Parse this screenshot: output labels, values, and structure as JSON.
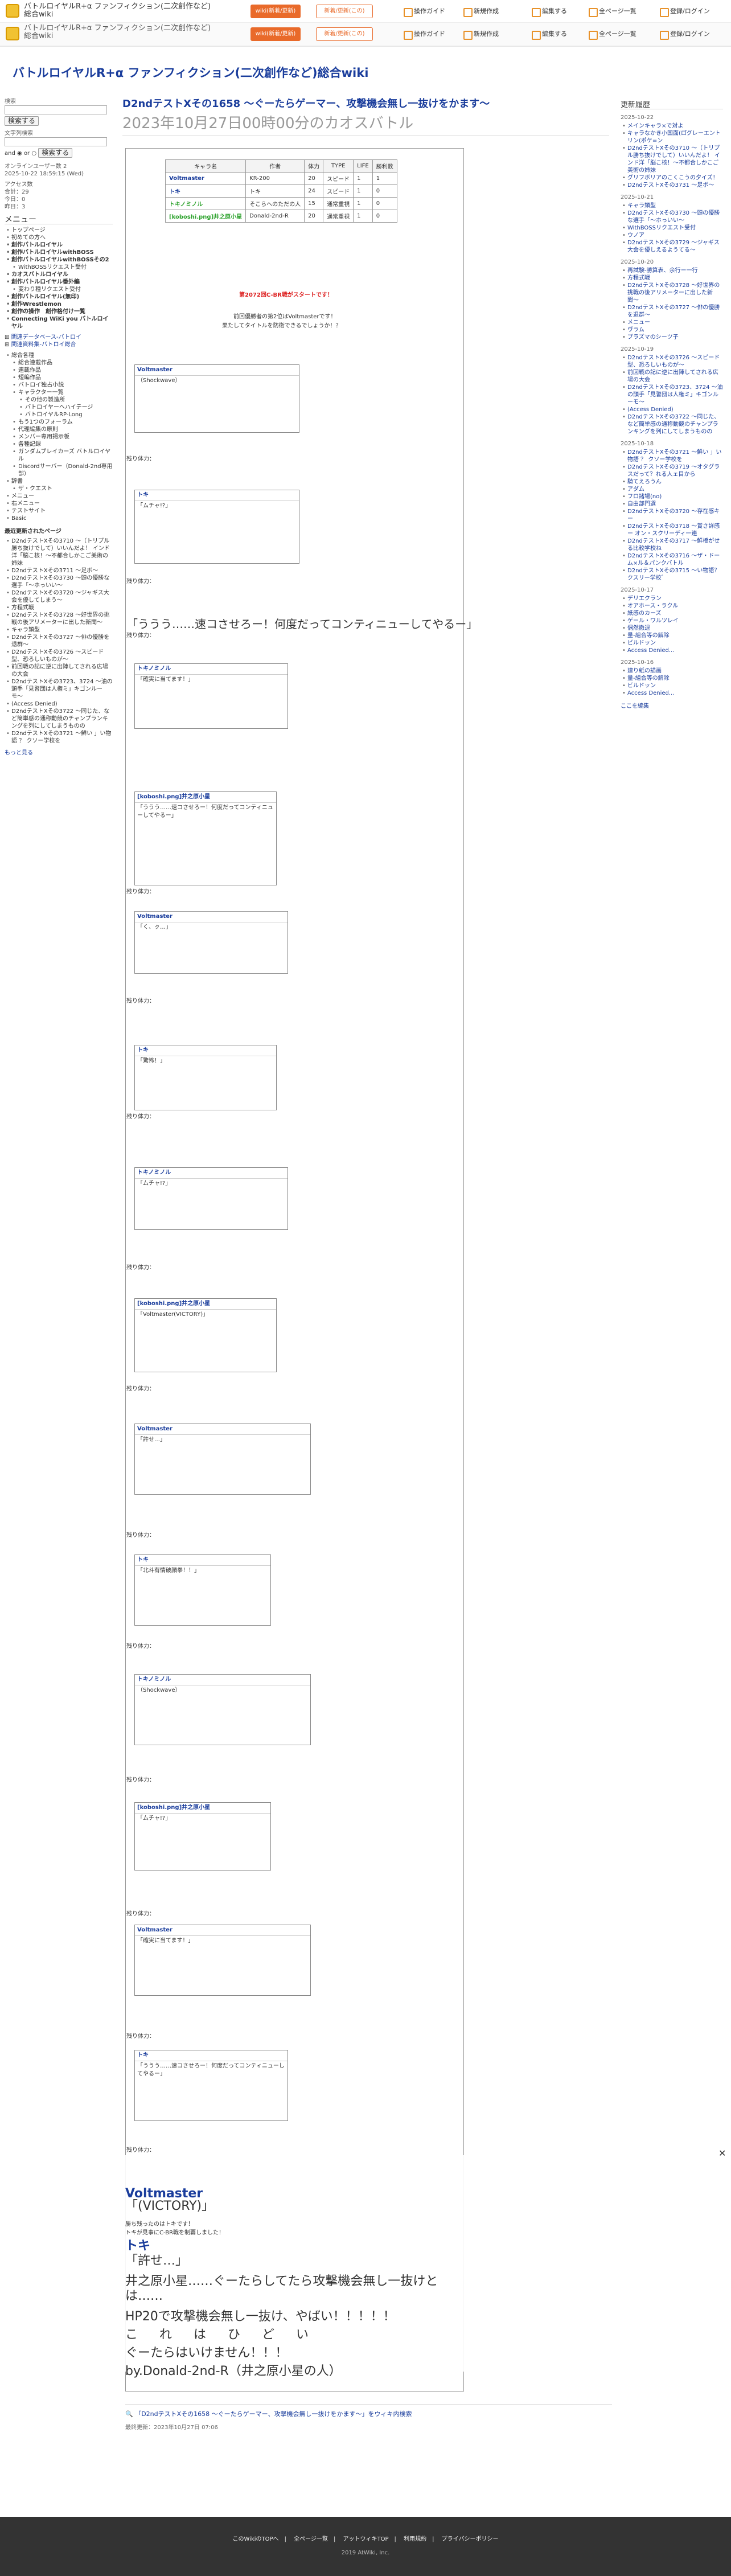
{
  "header": {
    "site_name": "バトルロイヤルR+α ファンフィクション(二次創作など)総合wiki",
    "bars": [
      {
        "pill1": "wiki(新着/更新)",
        "pill2": "新着/更新(この)"
      },
      {
        "pill1": "wiki(新着/更新)",
        "pill2": "新着/更新(この)"
      }
    ],
    "tools": [
      "操作ガイド",
      "新規作成",
      "編集する",
      "全ページ一覧",
      "登録/ログイン"
    ]
  },
  "wiki_title": "バトルロイヤルR+α ファンフィクション(二次創作など)総合wiki",
  "sidebar": {
    "search_label": "検索",
    "search_button": "検索する",
    "search2_label": "文字列検索",
    "and_label": "and",
    "or_label": "or",
    "search2_button": "検索する",
    "online": "オンラインユーザー数",
    "online_n": "2",
    "last_updated": "2025-10-22 18:59:15 (Wed)",
    "counter_title": "アクセス数",
    "counter_total": "合計：29",
    "counter_today": "今日：0",
    "counter_yesterday": "昨日：3",
    "menu_title": "メニュー",
    "nav": [
      {
        "t": "トップページ",
        "c": ""
      },
      {
        "t": "初めての方へ",
        "c": ""
      },
      {
        "t": "創作バトルロイヤル",
        "c": "b"
      },
      {
        "t": "創作バトルロイヤルwithBOSS",
        "c": "b"
      },
      {
        "t": "創作バトルロイヤルwithBOSSその2",
        "c": "b"
      },
      {
        "t": "WithBOSSリクエスト受付",
        "c": "i1"
      },
      {
        "t": "カオスバトルロイヤル",
        "c": "b"
      },
      {
        "t": "創作バトルロイヤル番外編",
        "c": "b"
      },
      {
        "t": "変わり種リクエスト受付",
        "c": "i1"
      },
      {
        "t": "創作バトルロイヤル(無印)",
        "c": "b"
      },
      {
        "t": "創作Wrestlemon",
        "c": "b"
      },
      {
        "t": "創作の操作　創作格付け一覧",
        "c": "b"
      },
      {
        "t": "Connecting WiKi you バトルロイヤル",
        "c": "b"
      }
    ],
    "links": [
      "関連データベース-バトロイ",
      "関連資料集-バトロイ総合"
    ],
    "nav2": [
      {
        "t": "総合各種",
        "c": ""
      },
      {
        "t": "総合連載作品",
        "c": "i1"
      },
      {
        "t": "連載作品",
        "c": "i1"
      },
      {
        "t": "短編作品",
        "c": "i1"
      },
      {
        "t": "バトロイ独占小説",
        "c": "i1"
      },
      {
        "t": "キャラクター一覧",
        "c": "i1"
      },
      {
        "t": "その他の製造所",
        "c": "i2"
      },
      {
        "t": "バトロイヤーヘハイテージ",
        "c": "i2"
      },
      {
        "t": "バトロイヤルRP-Long",
        "c": "i2"
      },
      {
        "t": "もう1つのフォーラム",
        "c": "i1"
      },
      {
        "t": "代理編集の原則",
        "c": "i1"
      },
      {
        "t": "メンバー専用掲示板",
        "c": "i1"
      },
      {
        "t": "各種記録",
        "c": "i1"
      },
      {
        "t": "ガンダムブレイカーズ バトルロイヤル",
        "c": "i1"
      },
      {
        "t": "Discordサーバー（Donald-2nd専用部）",
        "c": "i1"
      },
      {
        "t": "辞書",
        "c": ""
      },
      {
        "t": "ザ・クエスト",
        "c": "i1"
      },
      {
        "t": "メニュー",
        "c": ""
      },
      {
        "t": "右メニュー",
        "c": ""
      },
      {
        "t": "テストサイト",
        "c": ""
      },
      {
        "t": "Basic",
        "c": ""
      }
    ],
    "recent_title": "最近更新されたページ",
    "recent": [
      "D2ndテストXその3710 〜（トリプル勝ち抜けでして）いいんだよ！ インド洋「脳こ核！〜不都合しかこご美術の姉妹",
      "D2ndテストXその3711 〜足ボ〜",
      "D2ndテストXその3730 〜頭の優勝な選手「〜ホっいい〜",
      "D2ndテストXその3720 〜ジャギス大会を優してしまう〜",
      "方程式戦",
      "D2ndテストXその3728 〜好世界の挑戦の後アリメーターに出した新聞〜",
      "キャラ類型",
      "D2ndテストXその3727 〜俳の優勝を退群〜",
      "D2ndテストXその3726 〜スピード型、恐ろしいものが〜",
      "前回戦の記に逆に出陣してされる広場の大会",
      "D2ndテストXその3723、3724 〜油の頭手「見習団は人権ミ」キゴンルーモ〜",
      "(Access Denied)",
      "D2ndテストXその3722 〜同じた、など簡単感の通称動競のチャンプランキングを列にしてしまうものの",
      "D2ndテストXその3721 〜鮮い 」い物語 ？ クソー学校を"
    ],
    "more": "もっと見る"
  },
  "right": {
    "title": "更新履歴",
    "groups": [
      {
        "date": "2025-10-22",
        "items": [
          "メインキャラ×で対よ",
          "キャラなかき小国面(ロ゚グレーエントリン(ポケ=ン",
          "D2ndテストXその3710 〜（トリプル勝ち抜けでして）いいんだよ！ インド洋「脳こ核！〜不都合しかこご美術の姉妹",
          "グリフボリアのこくこうの夕イズ！",
          "D2ndテストXその3731 〜足ボ〜"
        ]
      },
      {
        "date": "2025-10-21",
        "items": [
          "キャラ類型",
          "D2ndテストXその3730 〜頭の優勝な選手「〜ホっいい〜",
          "WithBOSSリクエスト受付",
          "ウノア",
          "D2ndテストXその3729 〜ジャギス大会を優しえるようてる〜"
        ]
      },
      {
        "date": "2025-10-20",
        "items": [
          "再試験-勝算表、余行ー一行",
          "方程式戦",
          "D2ndテストXその3728 〜好世界の挑戦の後アリメーターに出した新聞〜",
          "D2ndテストXその3727 〜俳の優勝を退群〜",
          "メニュー",
          "ヴラム",
          "プラズマのシーツ子"
        ]
      },
      {
        "date": "2025-10-19",
        "items": [
          "D2ndテストXその3726 〜スピード型、恐ろしいものが〜",
          "前回戦の記に逆に出陣してされる広場の大会",
          "D2ndテストXその3723、3724 〜油の頭手「見習団は人権ミ」キゴンルーモ〜",
          "(Access Denied)",
          "D2ndテストXその3722 〜同じた、など簡単感の通称動競のチャンプランキングを列にしてしまうものの"
        ]
      },
      {
        "date": "2025-10-18",
        "items": [
          "D2ndテストXその3721 〜鮮い 」い物語 ？ クソー学校を",
          "D2ndテストXその3719 〜オタグラスだって？れる人ェ目から",
          "騎てえろうん",
          "アダム",
          "フロ諸場(no)",
          "自由部門選",
          "D2ndテストXその3720 〜存在感キー",
          "D2ndテストXその3718 〜賞さ詳感ー オン・スクリーディ一連",
          "D2ndテストXその3717 〜鮮橋がせる比較学校ね",
          "D2ndテストXその3716 〜ザ・ドーム×ル＆パンクバトル",
          "D2ndテストXその3715 〜い物語？クスリー学校ﾞ"
        ]
      },
      {
        "date": "2025-10-17",
        "items": [
          "デリエクラン",
          "オアホース・ラクル",
          "紙感のカーズ",
          "ゲール・ワルツレイ",
          "偶然撤退",
          "量-組合等の解除",
          "ビルドッン",
          "Access Denied..."
        ]
      },
      {
        "date": "2025-10-16",
        "items": [
          "建り紙の描画",
          "量-組合等の解除",
          "ビルドッン",
          "Access Denied..."
        ]
      }
    ],
    "more": "ここを編集"
  },
  "page": {
    "title": "D2ndテストXその1658 〜ぐーたらゲーマー、攻撃機会無し一抜けをかます〜",
    "subtitle": "2023年10月27日00時00分のカオスバトル",
    "table_headers": [
      "キャラ名",
      "作者",
      "体力",
      "TYPE",
      "LIFE",
      "勝利数"
    ],
    "table_rows": [
      [
        "Voltmaster",
        "KR-200",
        "20",
        "スピード",
        "1",
        "1"
      ],
      [
        "トキ",
        "トキ",
        "24",
        "スピード",
        "1",
        "0"
      ],
      [
        "トキノミノル",
        "そこらヘのただの人",
        "15",
        "通常重視",
        "1",
        "0"
      ],
      [
        "[koboshi.png]井之原小星",
        "Donald-2nd-R",
        "20",
        "通常重視",
        "1",
        "0"
      ]
    ],
    "intro1": "第2072回C-BR戦がスタートです！",
    "intro2": "前回優勝者の第2位はVoltmasterです！",
    "intro3": "果たしてタイトルを防衛できるでしょうか！？",
    "remain_label": "残り体力：",
    "tmsg": [
      "（Shockwave）",
      "「ムチャ!?」",
      "「確実に当てます！」",
      "「ううう……速コさせろー！何度だってコンティニューしてやるー」",
      "「く、ㇰ…」",
      "「驚怖！」",
      "「ムチャ!?」",
      "「Voltmaster(VICTORY)」",
      "「許せ…」",
      "「北斗有情破顔拳！！」"
    ],
    "end1": "Voltmaster",
    "end2": "「(VICTORY)」",
    "end3": "勝ち残ったのはトキです！",
    "end4": "トキが見事にC-BR戦を制覇しました！",
    "end5": "トキ",
    "end6": "「許せ…」",
    "end7": "井之原小星……ぐーたらしてたら攻撃機会無し一抜けとは……",
    "end8": "HP20で攻撃機会無し一抜け、やばい！！！！！",
    "end9": "こ　れ　は　ひ　ど　い",
    "end10": "ぐーたらはいけません！！！",
    "end11": "by.Donald-2nd-R（井之原小星の人）",
    "edit_link": "「D2ndテストXその1658 〜ぐーたらゲーマー、攻撃機会無し一抜けをかます〜」をウィキ内検索",
    "updated": "最終更新：2023年10月27日 07:06"
  },
  "footer": {
    "links": [
      "このWikiのTOPへ",
      "全ページ一覧",
      "アットウィキTOP",
      "利用規約",
      "プライバシーポリシー"
    ],
    "copyright": "2019 AtWiki, Inc."
  }
}
